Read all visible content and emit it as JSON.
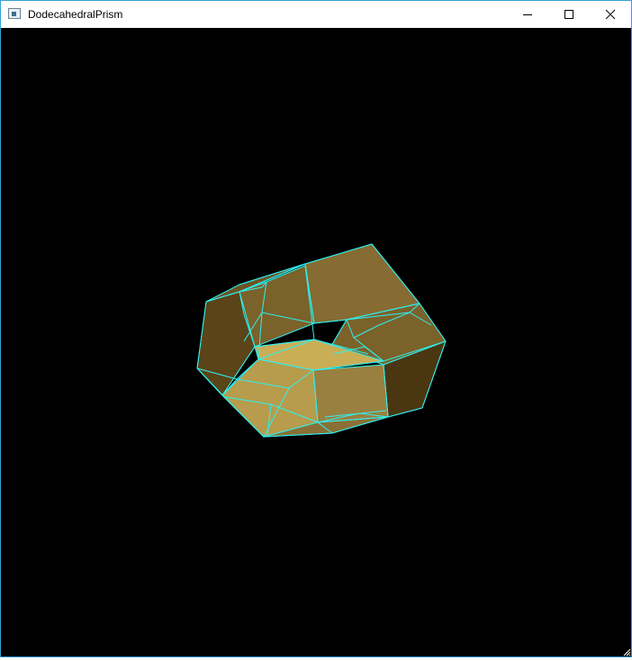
{
  "window": {
    "title": "DodecahedralPrism",
    "controls": {
      "minimize": "minimize-icon",
      "maximize": "maximize-icon",
      "close": "close-icon"
    }
  },
  "scene": {
    "background": "#000000",
    "edge_color": "#2ff0f0",
    "face_colors": [
      "#4a3712",
      "#5a4418",
      "#7a622a",
      "#866c32",
      "#a48b42",
      "#b69c4c",
      "#c9ae56"
    ]
  }
}
